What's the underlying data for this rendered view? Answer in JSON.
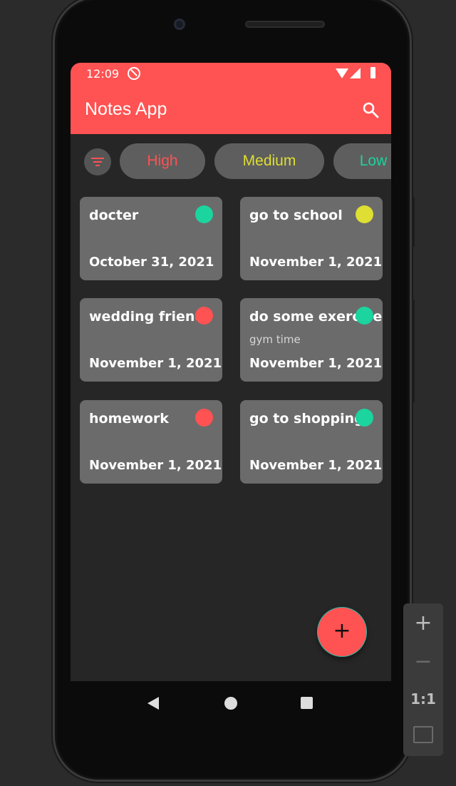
{
  "status_bar": {
    "time": "12:09"
  },
  "app_bar": {
    "title": "Notes App"
  },
  "filters": {
    "chips": [
      {
        "label": "High",
        "color": "#ff5252"
      },
      {
        "label": "Medium",
        "color": "#dede33"
      },
      {
        "label": "Low",
        "color": "#1bd49e"
      }
    ]
  },
  "notes": [
    {
      "title": "docter",
      "subtitle": "",
      "date": "October 31, 2021",
      "priority_color": "#1bd49e"
    },
    {
      "title": "go to school",
      "subtitle": "",
      "date": "November 1, 2021",
      "priority_color": "#dede33"
    },
    {
      "title": "wedding friend",
      "subtitle": "",
      "date": "November 1, 2021",
      "priority_color": "#ff5252"
    },
    {
      "title": "do some exercise",
      "subtitle": "gym time",
      "date": "November 1, 2021",
      "priority_color": "#1bd49e"
    },
    {
      "title": "homework",
      "subtitle": "",
      "date": "November 1, 2021",
      "priority_color": "#ff5252"
    },
    {
      "title": "go to shopping",
      "subtitle": "",
      "date": "November 1, 2021",
      "priority_color": "#1bd49e"
    }
  ],
  "fab": {
    "label": "+"
  },
  "zoom_controls": {
    "zoom_in": "+",
    "zoom_out": "−",
    "actual_size": "1:1"
  },
  "colors": {
    "accent": "#ff5252",
    "card_bg": "#6b6b6b",
    "screen_bg": "#262626"
  }
}
